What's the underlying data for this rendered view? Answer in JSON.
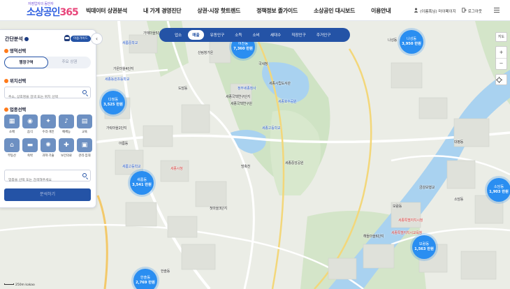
{
  "logo": {
    "tagline": "자영업자의 동반자",
    "name_a": "소상공인",
    "name_b": "365"
  },
  "nav": [
    "빅데이터 상권분석",
    "내 가게 경영진단",
    "상권·시장 핫트렌드",
    "정책정보 졸가이드",
    "소상공인 대시보드",
    "이용안내"
  ],
  "util": {
    "user": "(이름혹님) 마이페이지",
    "logout": "로그아웃"
  },
  "categories": [
    "업소",
    "매출",
    "유동인구",
    "소득",
    "소비",
    "세대수",
    "직장인구",
    "주거인구"
  ],
  "active_category": "매출",
  "panel": {
    "title": "간단분석",
    "guide": "이용가이드",
    "sections": {
      "area": "영역선택",
      "location": "위치선택",
      "industry": "업종선택"
    },
    "toggle": [
      "행정구역",
      "주요 상권"
    ],
    "location_placeholder": "주소, 상호명을 검색 또는 위치 선택",
    "industries": [
      "소매",
      "음식",
      "수리·개인",
      "예체능",
      "교육",
      "부동산",
      "숙박",
      "과학·기술",
      "보건의료",
      "관리·임대"
    ],
    "industry_placeholder": "업종을 선택 또는 검색해주세요",
    "analyze": "분석하기"
  },
  "clusters": [
    {
      "name": "나성동",
      "value": "3,950 만원"
    },
    {
      "name": "어진동",
      "value": "7,360 만원"
    },
    {
      "name": "다정동",
      "value": "3,525 만원"
    },
    {
      "name": "새롬동",
      "value": "3,541 만원"
    },
    {
      "name": "소담동",
      "value": "1,903 만원"
    },
    {
      "name": "보람동",
      "value": "1,563 만원"
    },
    {
      "name": "한솔동",
      "value": "2,769 만원"
    }
  ],
  "map_labels": [
    "가재마을5단지",
    "새롬중학교",
    "산림청가온",
    "국세청",
    "정부세종청사",
    "세종국책연구단지",
    "세종시립도서관",
    "세종호수공원",
    "세종국책연구원",
    "나성동",
    "세종동원초등학교",
    "도담동",
    "가온마을4단지",
    "세종특별자치시청",
    "세종고등학교",
    "가락마을2단지",
    "아름동",
    "해들마을6단지",
    "보람동",
    "소담동",
    "대평동",
    "세종중앙공원",
    "금강보행교",
    "세종특별자치시교육청",
    "한솔동",
    "첫마을3단지",
    "새롬고등학교",
    "방축천",
    "세종시청"
  ],
  "map_controls": {
    "map": "지도",
    "zoom_in": "+",
    "zoom_out": "−"
  },
  "scale": {
    "label": "250m",
    "brand": "kakao"
  }
}
